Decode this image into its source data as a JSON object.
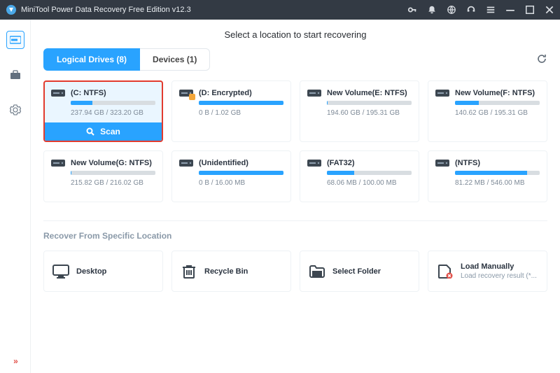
{
  "titlebar": {
    "title": "MiniTool Power Data Recovery Free Edition v12.3"
  },
  "page": {
    "heading": "Select a location to start recovering"
  },
  "tabs": {
    "logical": "Logical Drives (8)",
    "devices": "Devices (1)"
  },
  "scan_label": "Scan",
  "drives": [
    {
      "name": "(C: NTFS)",
      "sub": "237.94 GB / 323.20 GB",
      "fill": 26,
      "selected": true
    },
    {
      "name": "(D: Encrypted)",
      "sub": "0 B / 1.02 GB",
      "fill": 100,
      "locked": true
    },
    {
      "name": "New Volume(E: NTFS)",
      "sub": "194.60 GB / 195.31 GB",
      "fill": 1
    },
    {
      "name": "New Volume(F: NTFS)",
      "sub": "140.62 GB / 195.31 GB",
      "fill": 28
    },
    {
      "name": "New Volume(G: NTFS)",
      "sub": "215.82 GB / 216.02 GB",
      "fill": 1
    },
    {
      "name": "(Unidentified)",
      "sub": "0 B / 16.00 MB",
      "fill": 100
    },
    {
      "name": "(FAT32)",
      "sub": "68.06 MB / 100.00 MB",
      "fill": 32
    },
    {
      "name": "(NTFS)",
      "sub": "81.22 MB / 546.00 MB",
      "fill": 85
    }
  ],
  "section2": {
    "title": "Recover From Specific Location"
  },
  "locations": {
    "desktop": "Desktop",
    "recycle": "Recycle Bin",
    "folder": "Select Folder",
    "manual_title": "Load Manually",
    "manual_sub": "Load recovery result (*..."
  }
}
